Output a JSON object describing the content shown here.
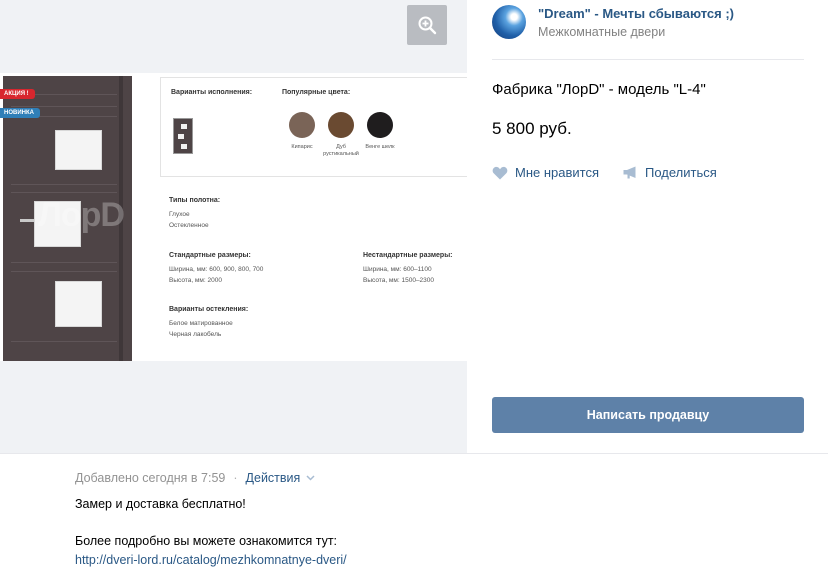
{
  "seller": {
    "name": "\"Dream\" - Мечты сбываются ;)",
    "category": "Межкомнатные двери"
  },
  "product": {
    "title": "Фабрика \"ЛорD\" - модель \"L-4\"",
    "price": "5 800 руб."
  },
  "actions": {
    "like_label": "Мне нравится",
    "share_label": "Поделиться",
    "contact_label": "Написать продавцу"
  },
  "image": {
    "tag_promo": "АКЦИЯ !",
    "tag_new": "НОВИНКА",
    "watermark": "ЛорD",
    "variants_heading": "Варианты исполнения:",
    "colors_heading": "Популярные цвета:",
    "colors": [
      {
        "label": "Кипарис",
        "color": "#7a6457"
      },
      {
        "label": "Дуб рустикальный",
        "color": "#6a4a31"
      },
      {
        "label": "Венге шелк",
        "color": "#1f1d1e"
      }
    ],
    "types_heading": "Типы полотна:",
    "types": [
      "Глухое",
      "Остекленное"
    ],
    "std_heading": "Стандартные размеры:",
    "std_lines": [
      "Ширина, мм: 600, 900, 800, 700",
      "Высота, мм: 2000"
    ],
    "nonstd_heading": "Нестандартные размеры:",
    "nonstd_lines": [
      "Ширина, мм: 600–1100",
      "Высота, мм: 1500–2300"
    ],
    "glass_heading": "Варианты остекления:",
    "glass_lines": [
      "Белое матированное",
      "Черная лакобель"
    ]
  },
  "post": {
    "added": "Добавлено сегодня в 7:59",
    "separator": "·",
    "actions_label": "Действия",
    "line1": "Замер и доставка бесплатно!",
    "line2": "Более подробно вы можете ознакомится тут:",
    "link": "http://dveri-lord.ru/catalog/mezhkomnatnye-dveri/"
  },
  "colors": {
    "link": "#2a5885",
    "button": "#5e81a8",
    "muted": "#828282"
  },
  "icons": [
    "zoom-in-icon",
    "heart-icon",
    "megaphone-icon",
    "chevron-down-icon"
  ]
}
